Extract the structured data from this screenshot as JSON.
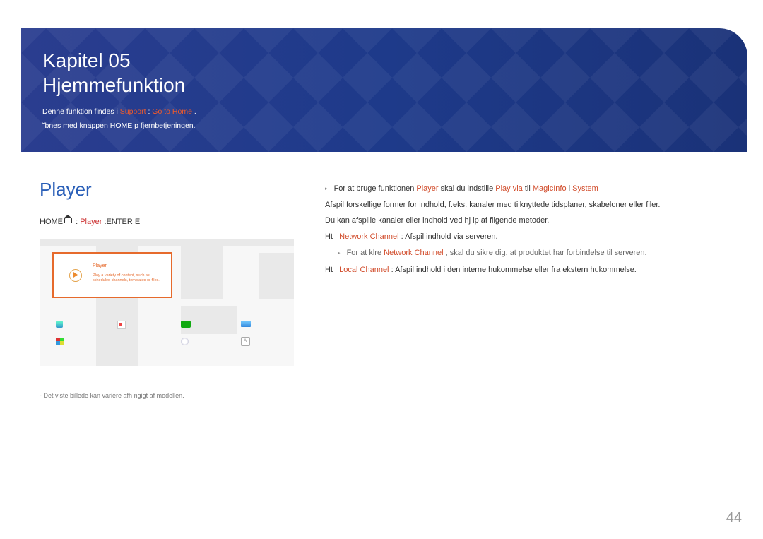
{
  "header": {
    "chapter_line1": "Kapitel 05",
    "chapter_line2": "Hjemmefunktion",
    "func_text1": "Denne funktion findes i ",
    "func_hl1": "Support",
    "func_sep": "  :  ",
    "func_hl2": "Go to Home",
    "func_text2": ".",
    "sub": "˘bnes med knappen HOME p fjernbetjeningen."
  },
  "left": {
    "title": "Player",
    "path_prefix": "HOME",
    "path_player": "Player",
    "path_enter": " :ENTER E",
    "tile_title": "Player",
    "tile_sub": "Play a variety of content, such as scheduled channels, templates or files.",
    "footnote": "Det viste billede kan variere afh ngigt af modellen."
  },
  "right": {
    "line1_a": "For at bruge funktionen ",
    "line1_hl1": "Player",
    "line1_b": " skal du indstille ",
    "line1_hl2": "Play via",
    "line1_c": " til ",
    "line1_hl3": "MagicInfo",
    "line1_d": " i ",
    "line1_hl4": "System",
    "line2": "Afspil forskellige former for indhold, f.eks. kanaler med tilknyttede tidsplaner, skabeloner eller filer.",
    "line3": "Du kan afspille kanaler eller indhold ved hj lp af fllgende metoder.",
    "net_label": "Network Channel",
    "net_text": ": Afspil indhold via serveren.",
    "net_sub_a": "For at klre ",
    "net_sub_hl": "Network Channel",
    "net_sub_b": ", skal du sikre dig, at produktet har forbindelse til serveren.",
    "loc_label": "Local Channel",
    "loc_text": ": Afspil indhold i den interne hukommelse eller fra ekstern hukommelse.",
    "ht": "Ht"
  },
  "page": "44"
}
